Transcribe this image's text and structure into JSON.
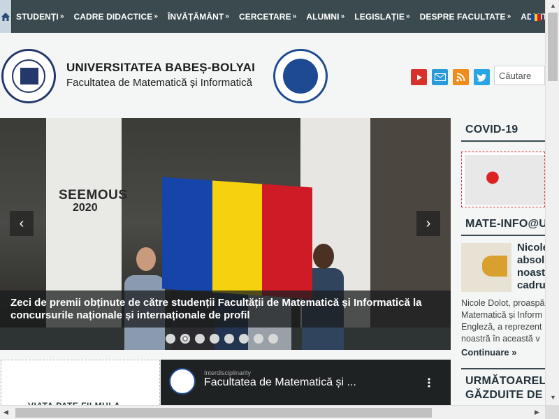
{
  "nav": {
    "items": [
      {
        "label": "STUDENȚI"
      },
      {
        "label": "CADRE DIDACTICE"
      },
      {
        "label": "ÎNVĂȚĂMÂNT"
      },
      {
        "label": "CERCETARE"
      },
      {
        "label": "ALUMNI"
      },
      {
        "label": "LEGISLAȚIE"
      },
      {
        "label": "DESPRE FACULTATE"
      },
      {
        "label": "ADMITERE"
      }
    ],
    "chevron": "»"
  },
  "header": {
    "university": "UNIVERSITATEA BABEȘ-BOLYAI",
    "faculty": "Facultatea de Matematică și Informatică",
    "search_placeholder": "Căutare"
  },
  "slider": {
    "banner_text": "SEEMOUS",
    "banner_year": "2020",
    "caption": "Zeci de premii obținute de către studenții Facultății de Matematică și Informatică la concursurile naționale și internaționale de profil",
    "prev": "‹",
    "next": "›",
    "slide_count": 8,
    "active_slide": 2
  },
  "bottom": {
    "card_title": "VIATA PATE FILMULA",
    "video_channel": "Interdisciplinarity",
    "video_title": "Facultatea de Matematică și ..."
  },
  "sidebar": {
    "covid_title": "COVID-19",
    "mate_title": "MATE-INFO@U",
    "news_title": "Nicole absol noast cadru",
    "news_body_lines": [
      "Nicole Dolot, proaspă",
      "Matematică și Inform",
      "Engleză, a reprezent",
      "noastră în această v"
    ],
    "continue_label": "Continuare »",
    "events_title_1": "URMĂTOAREL",
    "events_title_2": "GĂZDUITE DE"
  },
  "colors": {
    "nav_bg": "#3a4a4e",
    "accent_dark": "#24323a",
    "youtube": "#d8312b",
    "mail": "#2a9bd9",
    "rss": "#f08c1a",
    "twitter": "#2aa5e3",
    "flag_blue": "#1545a8",
    "flag_yellow": "#f6d10d",
    "flag_red": "#cf1b26"
  }
}
